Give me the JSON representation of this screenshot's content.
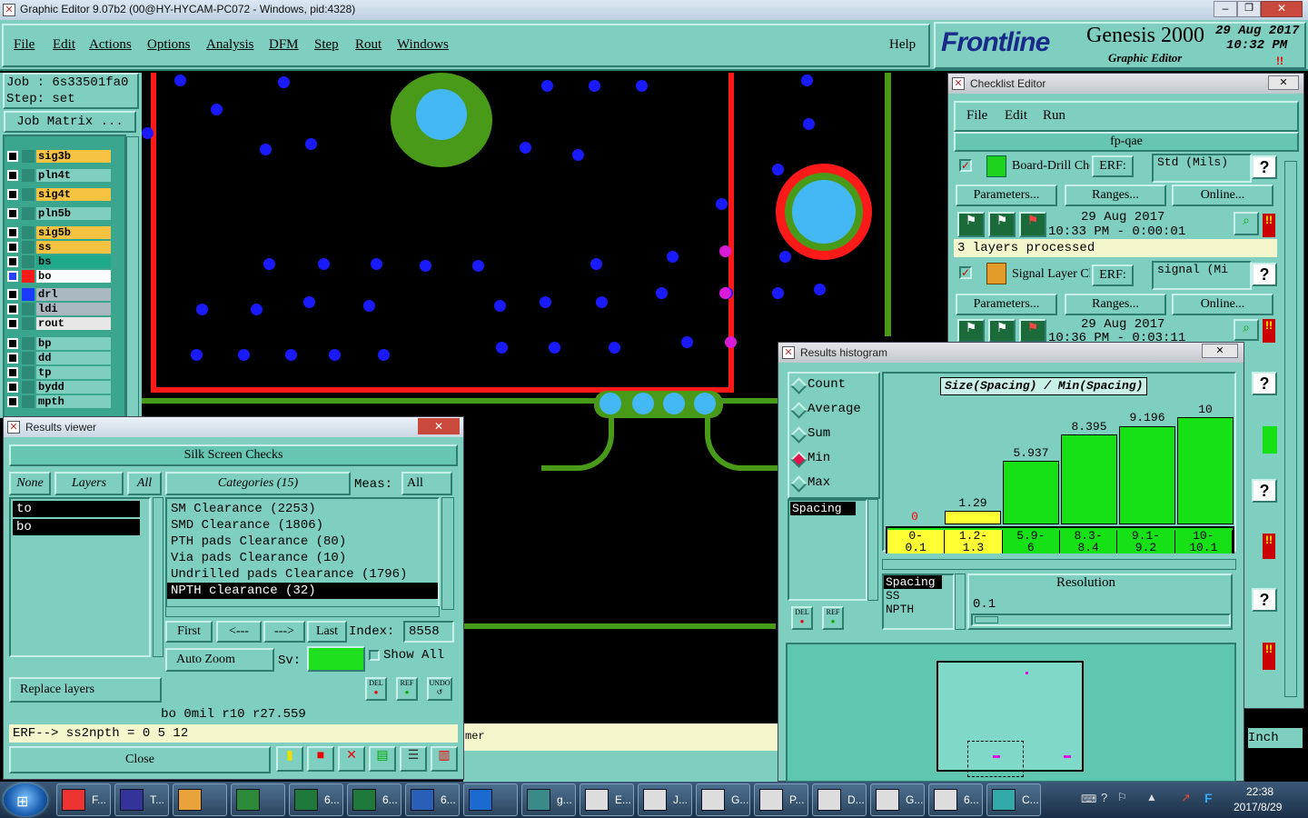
{
  "window": {
    "title": "Graphic Editor 9.07b2 (00@HY-HYCAM-PC072 - Windows, pid:4328)"
  },
  "menu": {
    "items": [
      "File",
      "Edit",
      "Actions",
      "Options",
      "Analysis",
      "DFM",
      "Step",
      "Rout",
      "Windows"
    ],
    "help": "Help"
  },
  "brand": {
    "logo": "Frontline",
    "product": "Genesis 2000",
    "sub": "Graphic Editor",
    "date": "29 Aug 2017",
    "time": "10:32 PM"
  },
  "job": {
    "job_label": "Job : 6s33501fa0",
    "step_label": "Step: set",
    "matrix_button": "Job Matrix ..."
  },
  "layers": [
    {
      "name": "sig3b",
      "color": "#f5c242"
    },
    {
      "name": "pln4t",
      "color": "#7fcfc0"
    },
    {
      "name": "sig4t",
      "color": "#f5c242"
    },
    {
      "name": "pln5b",
      "color": "#7fcfc0"
    },
    {
      "name": "sig5b",
      "color": "#f5c242"
    },
    {
      "name": "ss",
      "color": "#f5c242"
    },
    {
      "name": "bs",
      "color": "#1fa88a"
    },
    {
      "name": "bo",
      "color": "#ffffff"
    },
    {
      "name": "drl",
      "color": "#a9b8c0"
    },
    {
      "name": "ldi",
      "color": "#a9b8c0"
    },
    {
      "name": "rout",
      "color": "#e6e6e6"
    },
    {
      "name": "bp",
      "color": "#7fcfc0"
    },
    {
      "name": "dd",
      "color": "#7fcfc0"
    },
    {
      "name": "tp",
      "color": "#7fcfc0"
    },
    {
      "name": "bydd",
      "color": "#7fcfc0"
    },
    {
      "name": "mpth",
      "color": "#7fcfc0"
    }
  ],
  "results_viewer": {
    "title": "Results viewer",
    "header": "Silk Screen Checks",
    "none": "None",
    "layers": "Layers",
    "all": "All",
    "layer_list": [
      "to",
      "bo"
    ],
    "categories_label": "Categories (15)",
    "meas_label": "Meas:",
    "meas_value": "All",
    "categories": [
      "SM Clearance (2253)",
      "SMD Clearance (1806)",
      "PTH pads Clearance (80)",
      "Via pads Clearance (10)",
      "Undrilled pads Clearance (1796)",
      "NPTH clearance (32)"
    ],
    "nav": {
      "first": "First",
      "prev": "<---",
      "next": "--->",
      "last": "Last",
      "index_label": "Index:",
      "index_value": "8558"
    },
    "auto_zoom": "Auto Zoom",
    "sv_label": "Sv:",
    "show_all": "Show All",
    "replace_layers": "Replace layers",
    "status": "bo  0mil   r10   r27.559",
    "erf": "ERF--> ss2npth = 0 5 12",
    "close": "Close",
    "del": "DEL",
    "ref": "REF",
    "undo": "UNDO"
  },
  "bottom_fragment": "mer",
  "checklist": {
    "title": "Checklist Editor",
    "menu": [
      "File",
      "Edit",
      "Run"
    ],
    "name": "fp-qae",
    "actions": [
      {
        "name": "Board-Drill Che",
        "erf_label": "ERF:",
        "erf": "Std (Mils)",
        "help": "?",
        "date": "29 Aug 2017",
        "time": "10:33 PM - 0:00:01",
        "status": "3 layers processed"
      },
      {
        "name": "Signal Layer Ch",
        "erf_label": "ERF:",
        "erf": "signal (Mi",
        "help": "?",
        "date": "29 Aug 2017",
        "time": "10:36 PM - 0:03:11"
      }
    ],
    "parameters": "Parameters...",
    "ranges": "Ranges...",
    "online": "Online...",
    "inch": "Inch"
  },
  "histogram": {
    "title": "Results histogram",
    "modes": [
      "Count",
      "Average",
      "Sum",
      "Min",
      "Max"
    ],
    "selected_mode": "Min",
    "chart_title": "Size(Spacing) / Min(Spacing)",
    "types_list": [
      "Spacing"
    ],
    "bottom_list": [
      "Spacing",
      "SS",
      "NPTH"
    ],
    "resolution_label": "Resolution",
    "resolution_value": "0.1",
    "del": "DEL",
    "ref": "REF"
  },
  "chart_data": {
    "type": "bar",
    "title": "Size(Spacing) / Min(Spacing)",
    "categories": [
      "0-0.1",
      "1.2-1.3",
      "5.9-6",
      "8.3-8.4",
      "9.1-9.2",
      "10-10.1"
    ],
    "values": [
      0,
      1.29,
      5.937,
      8.395,
      9.196,
      10
    ],
    "value_labels": [
      "0",
      "1.29",
      "5.937",
      "8.395",
      "9.196",
      "10"
    ],
    "range_lines": [
      [
        "0-",
        "0.1"
      ],
      [
        "1.2-",
        "1.3"
      ],
      [
        "5.9-",
        "6"
      ],
      [
        "8.3-",
        "8.4"
      ],
      [
        "9.1-",
        "9.2"
      ],
      [
        "10-",
        "10.1"
      ]
    ],
    "ylim": [
      0,
      10
    ],
    "colors": {
      "zero": "#ff0000",
      "low": "#ffff33",
      "high": "#16e016"
    }
  },
  "taskbar": {
    "items": [
      "F...",
      "T...",
      "",
      "",
      "6...",
      "6...",
      "6...",
      "",
      "g...",
      "E...",
      "J...",
      "G...",
      "P...",
      "D...",
      "G...",
      "6...",
      "C..."
    ],
    "clock_time": "22:38",
    "clock_date": "2017/8/29"
  }
}
